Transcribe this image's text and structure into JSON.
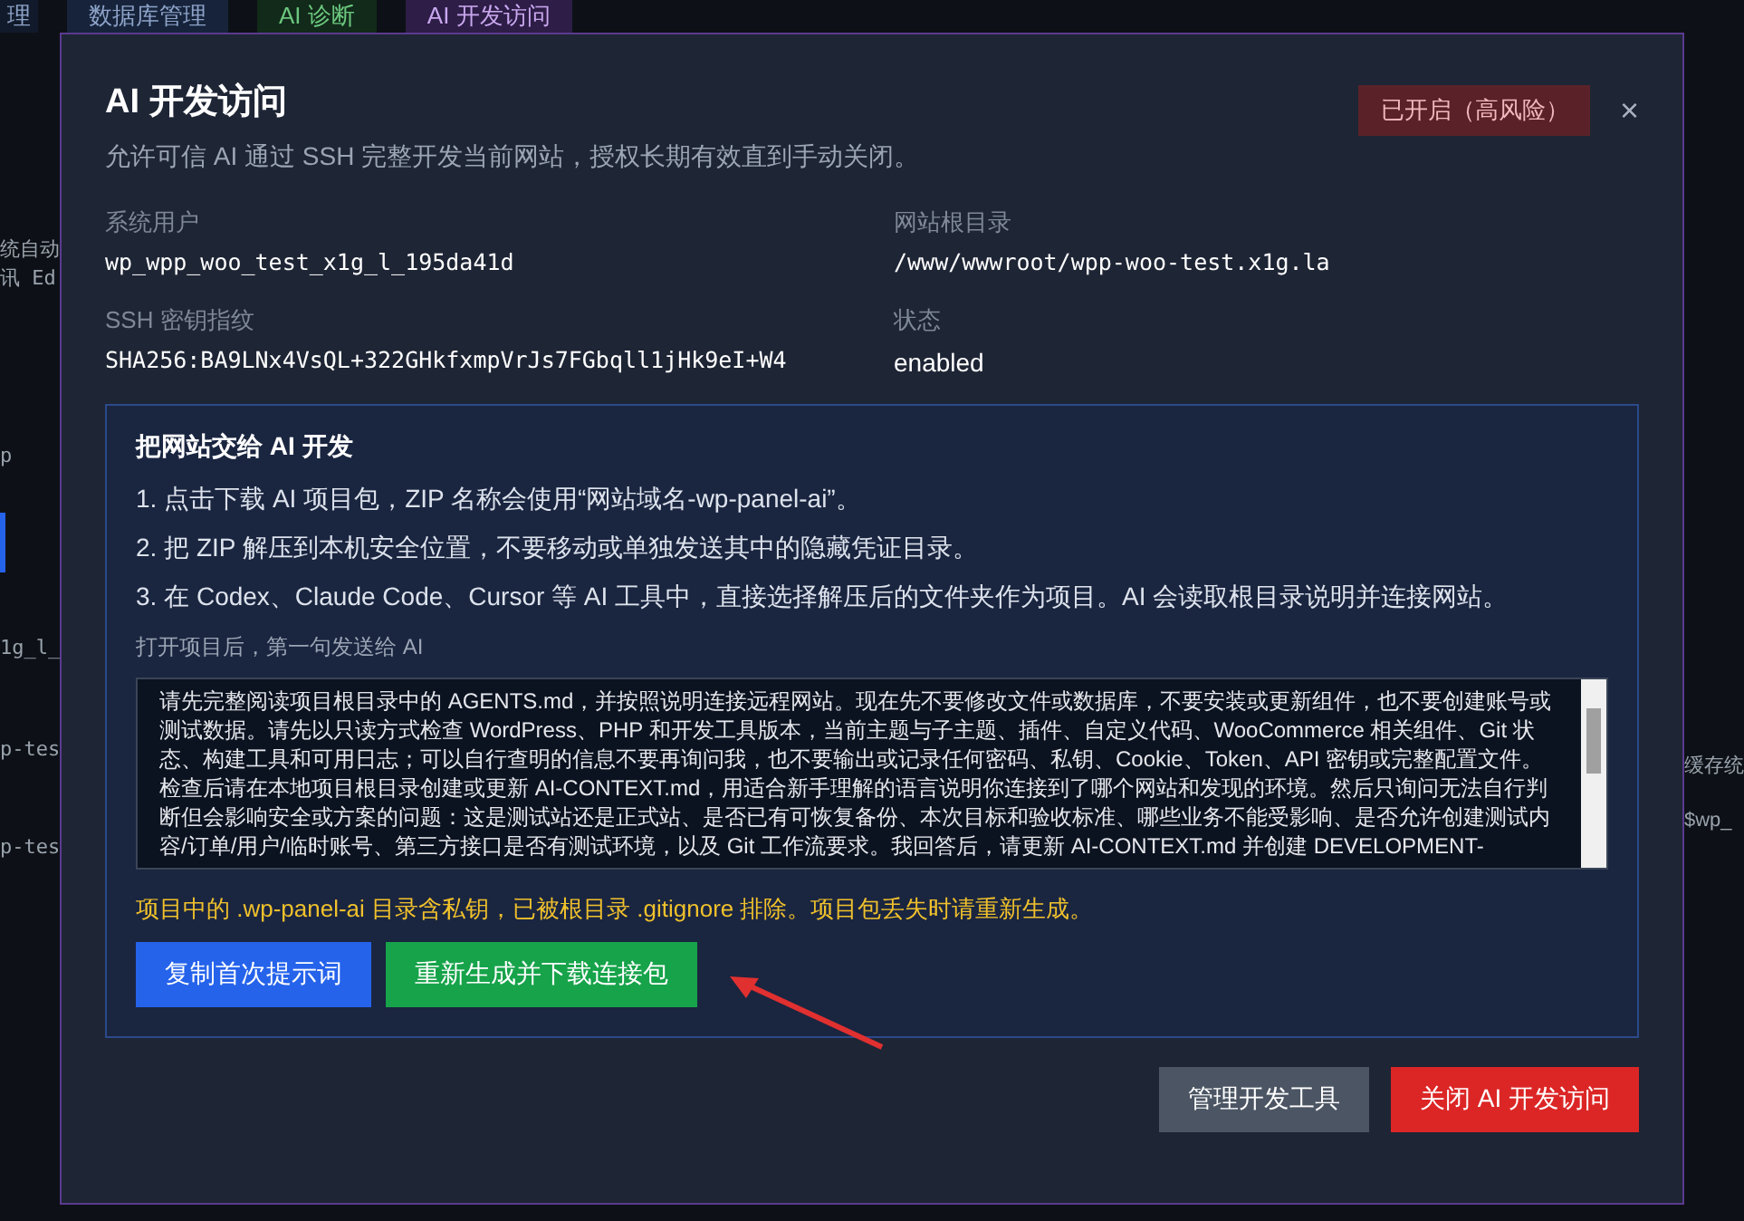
{
  "background": {
    "tabs": [
      {
        "label": "理",
        "selected": false
      },
      {
        "label": "数据库管理",
        "selected": false
      },
      {
        "label": "AI 诊断",
        "selected": false
      },
      {
        "label": "AI 开发访问",
        "selected": true
      }
    ],
    "left_fragments": [
      "统自动",
      "讯 Ed",
      "p",
      "1g_l_",
      "p-tes",
      "p-tes"
    ],
    "right_fragments": [
      "缓存统",
      "$wp_"
    ]
  },
  "dialog": {
    "title": "AI 开发访问",
    "subtitle": "允许可信 AI 通过 SSH 完整开发当前网站，授权长期有效直到手动关闭。",
    "status_badge": "已开启（高风险）",
    "close": "×",
    "fields": [
      {
        "label": "系统用户",
        "value": "wp_wpp_woo_test_x1g_l_195da41d",
        "kind": "mono"
      },
      {
        "label": "网站根目录",
        "value": "/www/wwwroot/wpp-woo-test.x1g.la",
        "kind": "mono"
      },
      {
        "label": "SSH 密钥指纹",
        "value": "SHA256:BA9LNx4VsQL+322GHkfxmpVrJs7FGbqll1jHk9eI+W4",
        "kind": "mono"
      },
      {
        "label": "状态",
        "value": "enabled",
        "kind": "plain"
      }
    ],
    "handoff": {
      "title": "把网站交给 AI 开发",
      "steps": [
        "1. 点击下载 AI 项目包，ZIP 名称会使用“网站域名-wp-panel-ai”。",
        "2. 把 ZIP 解压到本机安全位置，不要移动或单独发送其中的隐藏凭证目录。",
        "3. 在 Codex、Claude Code、Cursor 等 AI 工具中，直接选择解压后的文件夹作为项目。AI 会读取根目录说明并连接网站。"
      ],
      "prompt_label": "打开项目后，第一句发送给 AI",
      "prompt": "请先完整阅读项目根目录中的 AGENTS.md，并按照说明连接远程网站。现在先不要修改文件或数据库，不要安装或更新组件，也不要创建账号或测试数据。请先以只读方式检查 WordPress、PHP 和开发工具版本，当前主题与子主题、插件、自定义代码、WooCommerce 相关组件、Git 状态、构建工具和可用日志；可以自行查明的信息不要再询问我，也不要输出或记录任何密码、私钥、Cookie、Token、API 密钥或完整配置文件。检查后请在本地项目根目录创建或更新 AI-CONTEXT.md，用适合新手理解的语言说明你连接到了哪个网站和发现的环境。然后只询问无法自行判断但会影响安全或方案的问题：这是测试站还是正式站、是否已有可恢复备份、本次目标和验收标准、哪些业务不能受影响、是否允许创建测试内容/订单/用户/临时账号、第三方接口是否有测试环境，以及 Git 工作流要求。我回答后，请更新 AI-CONTEXT.md 并创建 DEVELOPMENT-",
      "warning": "项目中的 .wp-panel-ai 目录含私钥，已被根目录 .gitignore 排除。项目包丢失时请重新生成。",
      "buttons": [
        {
          "label": "复制首次提示词",
          "kind": "primary"
        },
        {
          "label": "重新生成并下载连接包",
          "kind": "success"
        }
      ]
    },
    "footer_buttons": [
      {
        "label": "管理开发工具",
        "kind": "secondary"
      },
      {
        "label": "关闭 AI 开发访问",
        "kind": "danger"
      }
    ]
  }
}
